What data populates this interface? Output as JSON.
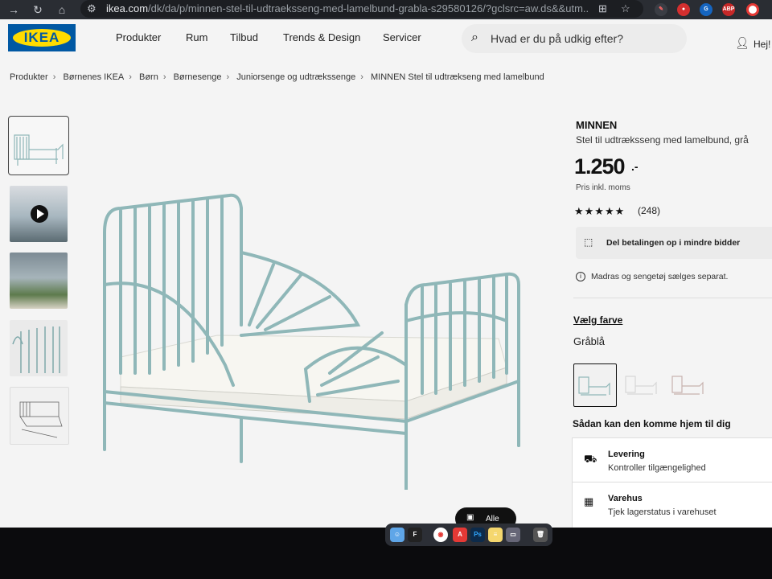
{
  "browser": {
    "url_host": "ikea.com",
    "url_path": "/dk/da/p/minnen-stel-til-udtraeksseng-med-lamelbund-grabla-s29580126/?gclsrc=aw.ds&&utm...",
    "back_icon": "arrow-right-icon",
    "extension_label": "ABP"
  },
  "header": {
    "logo_text": "IKEA",
    "nav": [
      "Produkter",
      "Rum",
      "Tilbud",
      "Trends & Design",
      "Servicer"
    ],
    "search_placeholder": "Hvad er du på udkig efter?",
    "user_label": "Hej!"
  },
  "breadcrumb": [
    "Produkter",
    "Børnenes IKEA",
    "Børn",
    "Børnesenge",
    "Juniorsenge og udtrækssenge",
    "MINNEN Stel til udtrækseng med lamelbund"
  ],
  "product": {
    "name": "MINNEN",
    "description": "Stel til udtræksseng med lamelbund, grå",
    "price": "1.250",
    "price_suffix": ".-",
    "price_note": "Pris inkl. moms",
    "rating": 4.5,
    "rating_max": 5,
    "stars": "★★★★★",
    "review_count": "(248)",
    "payment_label": "Del betalingen op i mindre bidder",
    "info_label": "Madras og sengetøj sælges separat.",
    "choose_color_label": "Vælg farve",
    "color_name": "Gråblå",
    "delivery_heading": "Sådan kan den komme hjem til dig",
    "delivery": {
      "title": "Levering",
      "subtitle": "Kontroller tilgængelighed"
    },
    "store": {
      "title": "Varehus",
      "subtitle": "Tjek lagerstatus i varehuset"
    },
    "all_images_label": "Alle",
    "colors": {
      "bed_frame": "#8fb7b8",
      "price_text": "#111111",
      "ikea_blue": "#0058a3",
      "ikea_yellow": "#ffdb00"
    }
  }
}
